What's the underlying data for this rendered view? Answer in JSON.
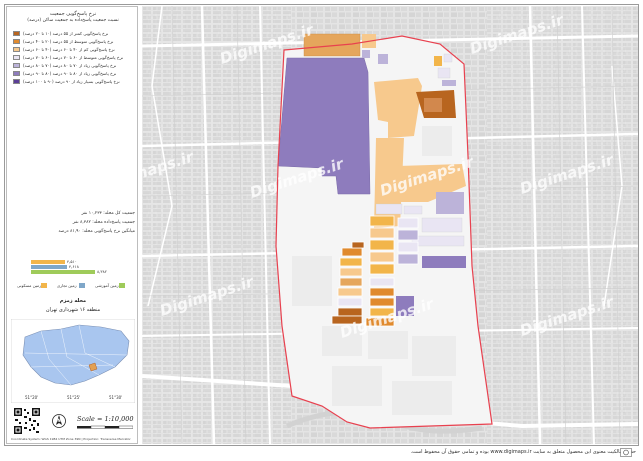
{
  "legend": {
    "title_1": "نرخ پاسخ‌گویی جمعیت",
    "title_2": "نسبت جمعیت پاسخ‌داده به جمعیت ساکن (درصد)",
    "classes": [
      {
        "label": "نرخ پاسخ‌گویی کمتر از ۵۵ درصد (۱۰ تا ۲۰ درصد)",
        "color": "#b8651f"
      },
      {
        "label": "نرخ پاسخ‌گویی متوسط از ۵۵ درصد (۲۰ تا ۴۰ درصد)",
        "color": "#e08a2e"
      },
      {
        "label": "نرخ پاسخ‌گویی کم از ۴۰ تا ۶۰ درصد (۴۰ تا ۶۰ درصد)",
        "color": "#f7c98d"
      },
      {
        "label": "نرخ پاسخ‌گویی متوسط از ۶۰ تا ۷۰ درصد (۶۰ تا ۷۰ درصد)",
        "color": "#e9e5f3"
      },
      {
        "label": "نرخ پاسخ‌گویی زیاد از ۷۰ تا ۸۰ درصد (۷۰ تا ۸۰ درصد)",
        "color": "#bcb3d9"
      },
      {
        "label": "نرخ پاسخ‌گویی زیاد از ۸۰ تا ۹۰ درصد (۸۰ تا ۹۰ درصد)",
        "color": "#8e7cbd"
      },
      {
        "label": "نرخ پاسخ‌گویی بسیار زیاد از ۹۰ درصد (۹۰ تا ۱۰۰ درصد)",
        "color": "#5b3e96"
      }
    ],
    "stats": [
      "جمعیت کل محله:  ۱۰,۲۳۳ نفر",
      "جمعیت پاسخ‌داده محله:  ۸,۳۸۲ نفر",
      "میانگین نرخ پاسخ‌گویی محله:  ۸۱,۹۰ درصد"
    ],
    "bars": [
      {
        "value": "۴,۵۱۰",
        "fraction": 0.32,
        "color": "#f2b54a"
      },
      {
        "value": "۴,۶۱۸",
        "fraction": 0.33,
        "color": "#7fa7c9"
      },
      {
        "value": "۸,۳۸۲",
        "fraction": 0.6,
        "color": "#9fcb5a"
      }
    ],
    "landuse": [
      {
        "label": "زمین مسکونی",
        "color": "#f2b54a"
      },
      {
        "label": "زمین تجاری",
        "color": "#7fa7c9"
      },
      {
        "label": "زمین آموزشی",
        "color": "#9fcb5a"
      }
    ],
    "area_title": "محله زمزم",
    "district_title": "منطقه ۱۶ شهرداری تهران",
    "inset_ticks": [
      "51°20'",
      "51°25'",
      "51°30'"
    ],
    "scale": "Scale = 1:10,000",
    "crs": "Coordinate System: WGS 1984 UTM Zone 39N | Projection: Transverse Mercator",
    "colors": {
      "boundary": "#e8414f",
      "inset_fill": "#a9c6ef",
      "inset_highlight": "#e3a052"
    }
  },
  "map": {
    "watermark": "Digimaps.ir",
    "boundary_color": "#e8414f"
  },
  "footer": {
    "text": "حقوق مالکیت معنوی این محصول متعلق به سایت www.digimaps.ir بوده و تمامی حقوق آن محفوظ است."
  }
}
